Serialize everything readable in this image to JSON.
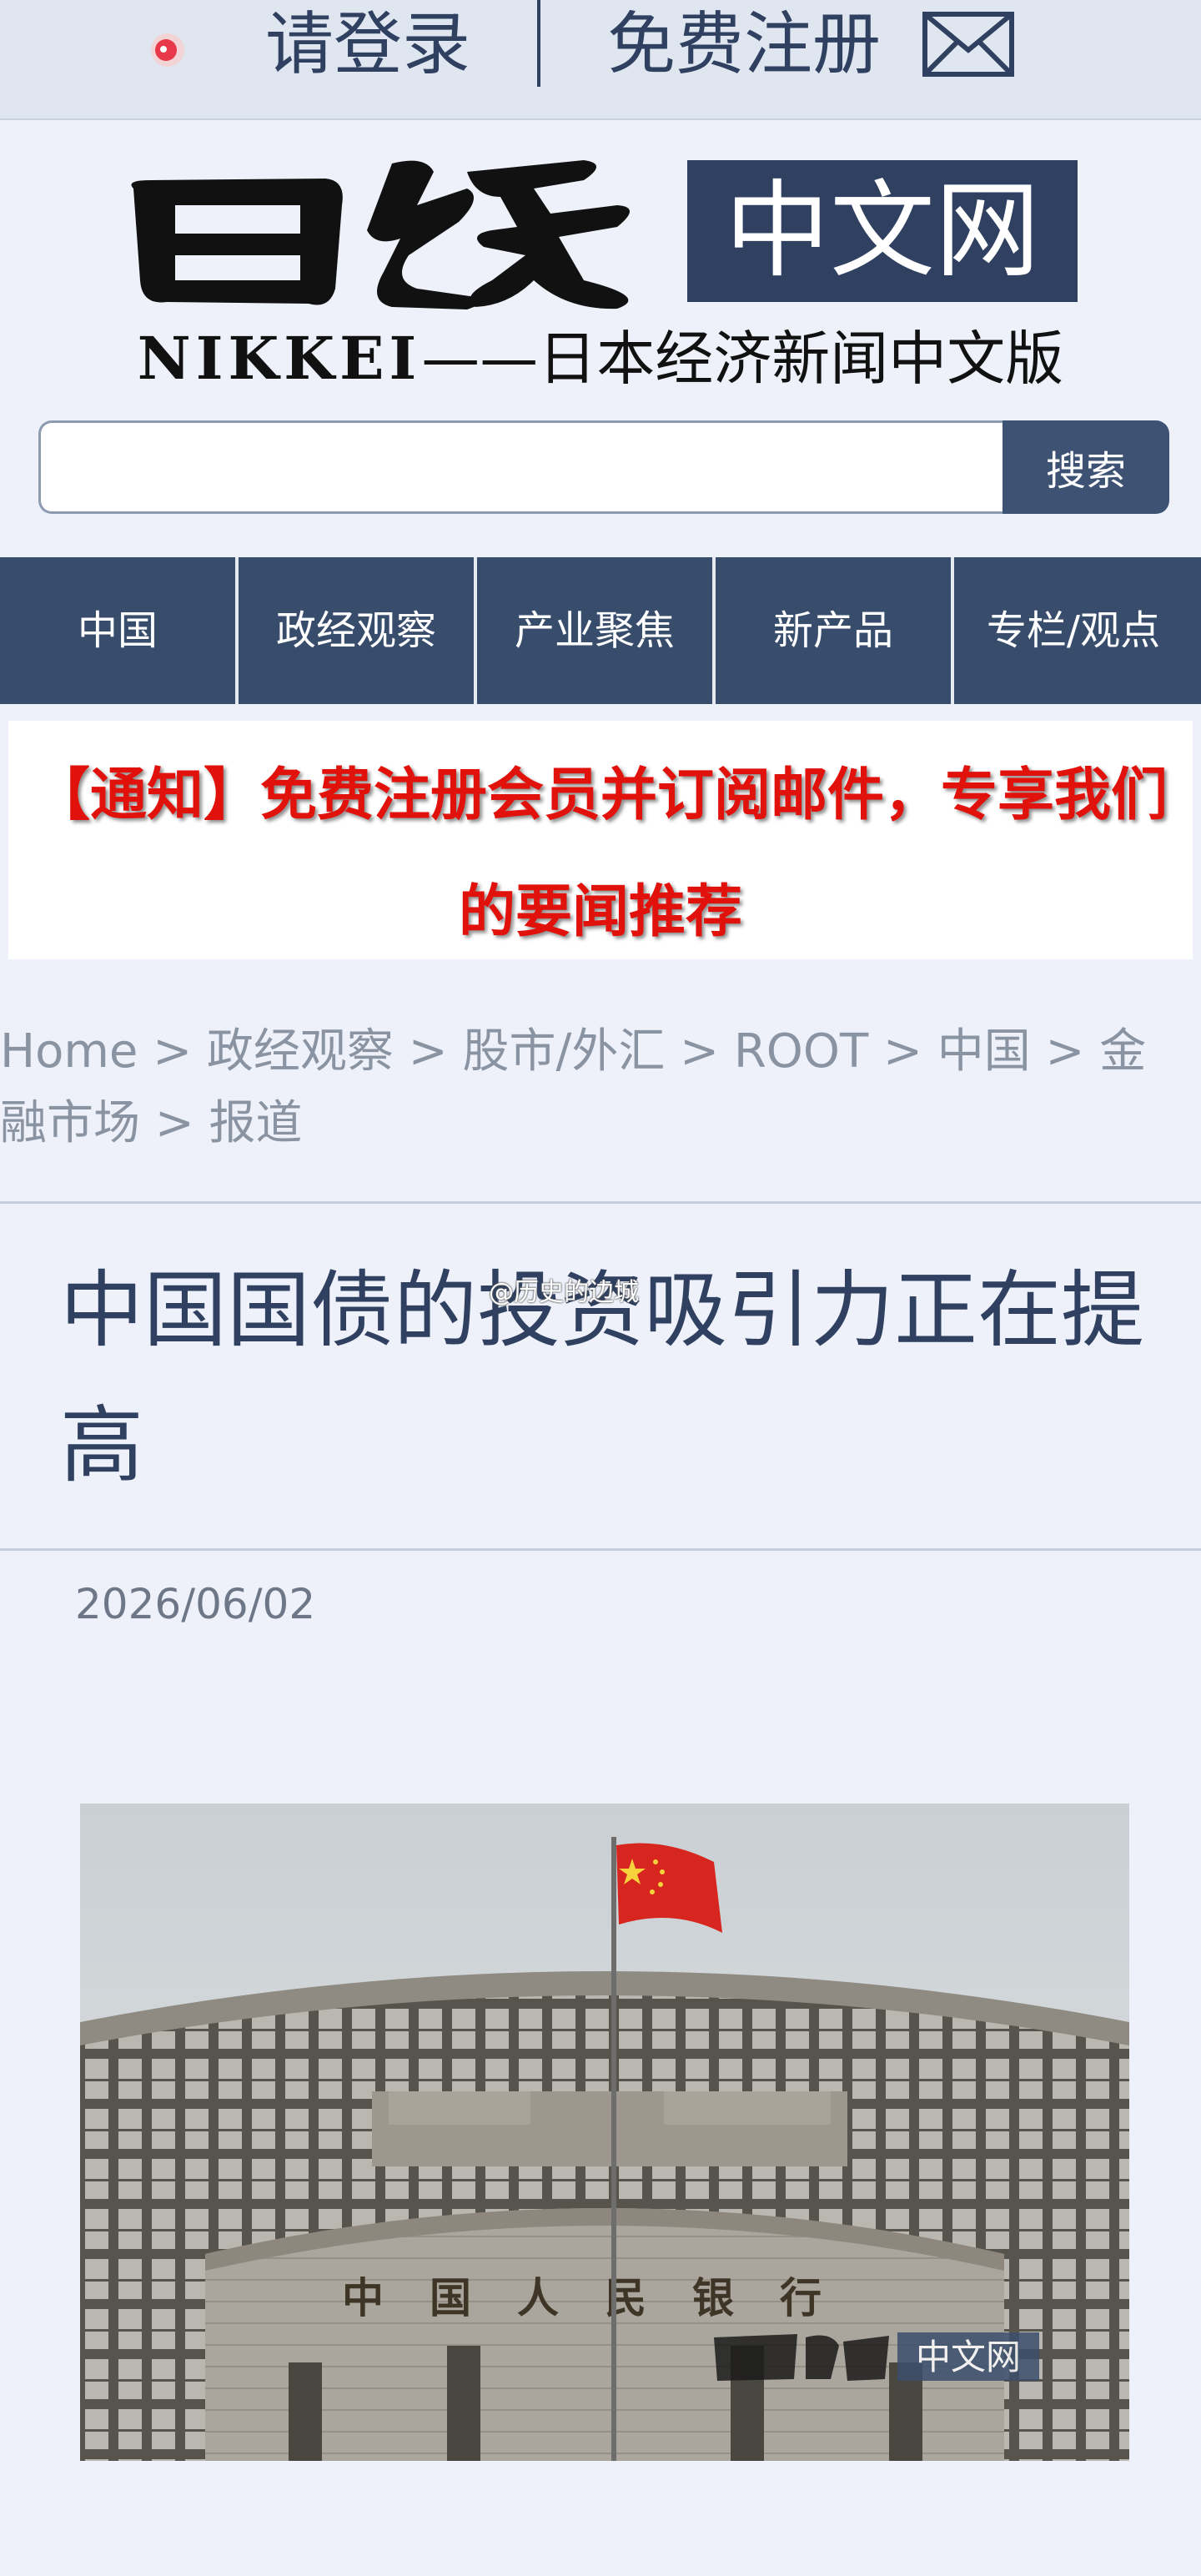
{
  "topbar": {
    "login_label": "请登录",
    "register_label": "免费注册",
    "user_icon": "user-dot-icon",
    "mail_icon": "mail-icon"
  },
  "logo": {
    "box_text": "中文网",
    "tagline_brand": "NIKKEI",
    "tagline_rest": "——日本经济新闻中文版"
  },
  "search": {
    "value": "",
    "placeholder": "",
    "button_label": "搜索"
  },
  "nav": {
    "items": [
      {
        "label": "中国"
      },
      {
        "label": "政经观察"
      },
      {
        "label": "产业聚焦"
      },
      {
        "label": "新产品"
      },
      {
        "label": "专栏/观点"
      }
    ]
  },
  "notice": {
    "text": "【通知】免费注册会员并订阅邮件，专享我们的要闻推荐"
  },
  "breadcrumb": {
    "separator": ">",
    "items": [
      "Home",
      "政经观察",
      "股市/外汇",
      "ROOT",
      "中国",
      "金融市场",
      "报道"
    ]
  },
  "article": {
    "title": "中国国债的投资吸引力正在提高",
    "watermark": "@历史的边城",
    "date": "2026/06/02",
    "photo": {
      "building_sign": "中国人民银行",
      "logo_watermark": "中文网"
    }
  },
  "colors": {
    "navy": "#384d6c",
    "notice_red": "#e1110b",
    "page_bg": "#eef1f9"
  }
}
